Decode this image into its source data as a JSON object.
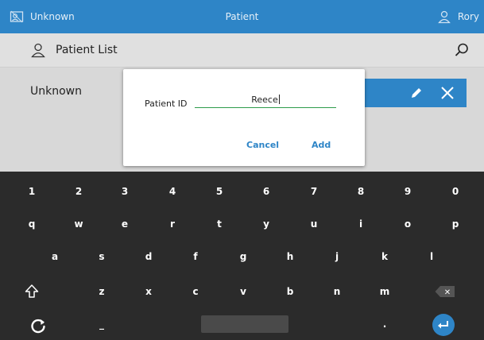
{
  "header": {
    "left_label": "Unknown",
    "center_title": "Patient",
    "user_name": "Rory"
  },
  "subheader": {
    "title": "Patient List"
  },
  "content": {
    "row_label": "Unknown"
  },
  "dialog": {
    "field_label": "Patient ID",
    "field_value": "Reece",
    "cancel_label": "Cancel",
    "add_label": "Add"
  },
  "keyboard": {
    "row_numbers": [
      "1",
      "2",
      "3",
      "4",
      "5",
      "6",
      "7",
      "8",
      "9",
      "0"
    ],
    "row_top": [
      "q",
      "w",
      "e",
      "r",
      "t",
      "y",
      "u",
      "i",
      "o",
      "p"
    ],
    "row_home": [
      "a",
      "s",
      "d",
      "f",
      "g",
      "h",
      "j",
      "k",
      "l"
    ],
    "row_bottom": [
      "z",
      "x",
      "c",
      "v",
      "b",
      "n",
      "m"
    ],
    "underscore": "_",
    "period": ".",
    "backspace_glyph": "✕"
  },
  "colors": {
    "accent": "#2e85c7",
    "field_underline": "#2e9c4a",
    "keyboard_bg": "#2b2b2b"
  }
}
